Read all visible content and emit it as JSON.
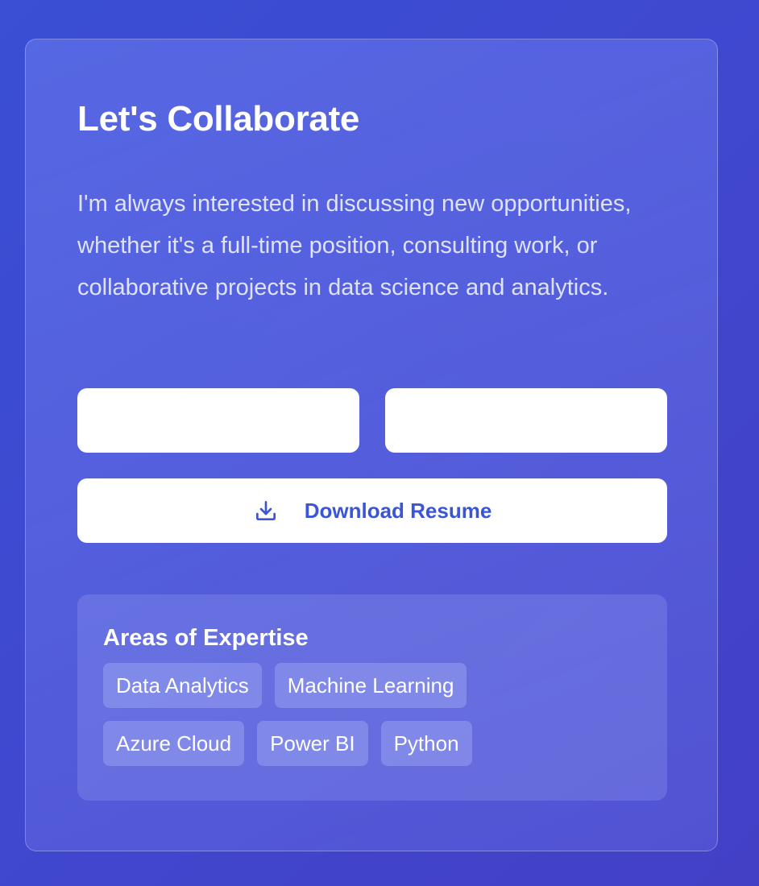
{
  "contact": {
    "title": "Let's Collaborate",
    "description": "I'm always interested in discussing new opportunities, whether it's a full-time position, consulting work, or collaborative projects in data science and analytics.",
    "inputs": [
      {
        "value": "",
        "placeholder": ""
      },
      {
        "value": "",
        "placeholder": ""
      }
    ],
    "download": {
      "label": "Download Resume",
      "icon": "download-icon"
    }
  },
  "expertise": {
    "title": "Areas of Expertise",
    "tags": [
      "Data Analytics",
      "Machine Learning",
      "Azure Cloud",
      "Power BI",
      "Python"
    ]
  },
  "colors": {
    "background": "#3f48cf",
    "accent": "#3a55d6",
    "white": "#ffffff"
  }
}
